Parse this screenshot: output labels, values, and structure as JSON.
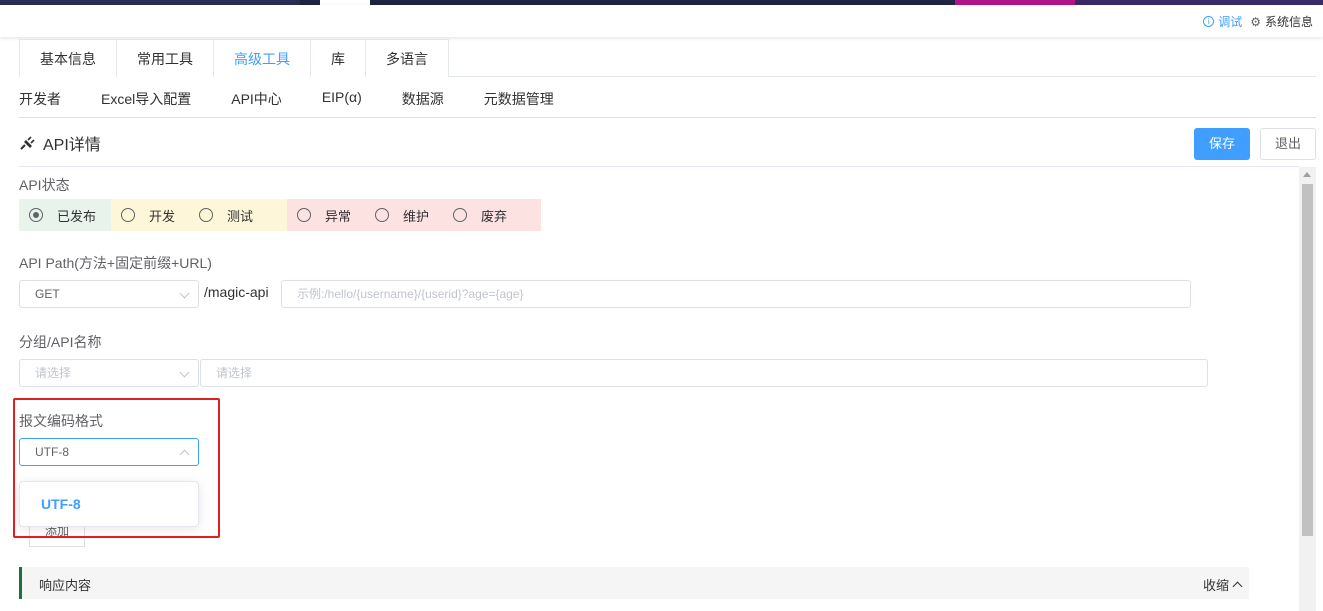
{
  "header": {
    "debug_label": "调试",
    "sysinfo_label": "系统信息"
  },
  "tabs": [
    "基本信息",
    "常用工具",
    "高级工具",
    "库",
    "多语言"
  ],
  "active_tab": "高级工具",
  "subnav": [
    "开发者",
    "Excel导入配置",
    "API中心",
    "EIP(α)",
    "数据源",
    "元数据管理"
  ],
  "page": {
    "title": "API详情",
    "save_label": "保存",
    "exit_label": "退出"
  },
  "form": {
    "status_label": "API状态",
    "statuses": [
      {
        "label": "已发布",
        "checked": true,
        "color": "#e8f3ec"
      },
      {
        "label": "开发",
        "checked": false,
        "color": "#fdf6d8"
      },
      {
        "label": "测试",
        "checked": false,
        "color": "#fdf6d8"
      },
      {
        "label": "异常",
        "checked": false,
        "color": "#fde2e2"
      },
      {
        "label": "维护",
        "checked": false,
        "color": "#fde2e2"
      },
      {
        "label": "废弃",
        "checked": false,
        "color": "#fde2e2"
      }
    ],
    "path_label": "API Path(方法+固定前缀+URL)",
    "method_value": "GET",
    "path_prefix": "/magic-api",
    "path_placeholder": "示例:/hello/{username}/{userid}?age={age}",
    "group_label": "分组/API名称",
    "group_placeholder": "请选择",
    "name_placeholder": "请选择",
    "encoding_label": "报文编码格式",
    "encoding_value": "UTF-8",
    "encoding_options": [
      "UTF-8"
    ],
    "add_label": "添加"
  },
  "response": {
    "title": "响应内容",
    "collapse_label": "收缩"
  },
  "colors": {
    "accent": "#409eff",
    "highlight_border": "#e02020",
    "response_bar_accent": "#1f6f43"
  }
}
